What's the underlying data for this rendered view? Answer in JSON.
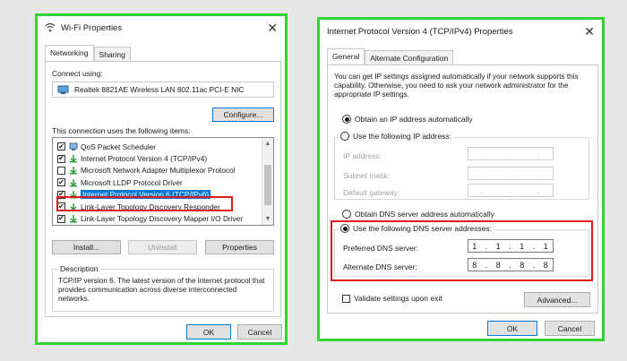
{
  "wifi_dialog": {
    "title": "Wi-Fi Properties",
    "tabs": [
      "Networking",
      "Sharing"
    ],
    "connect_using_label": "Connect using:",
    "adapter_name": "Realtek 8821AE Wireless LAN 802.11ac PCI-E NIC",
    "configure_label": "Configure...",
    "items_label": "This connection uses the following items:",
    "items": [
      {
        "label": "QoS Packet Scheduler",
        "checked": true,
        "icon": "qos-icon"
      },
      {
        "label": "Internet Protocol Version 4 (TCP/IPv4)",
        "checked": true,
        "icon": "protocol-icon"
      },
      {
        "label": "Microsoft Network Adapter Multiplexor Protocol",
        "checked": false,
        "icon": "protocol-icon"
      },
      {
        "label": "Microsoft LLDP Protocol Driver",
        "checked": true,
        "icon": "protocol-icon"
      },
      {
        "label": "Internet Protocol Version 6 (TCP/IPv6)",
        "checked": true,
        "icon": "protocol-icon",
        "selected": true
      },
      {
        "label": "Link-Layer Topology Discovery Responder",
        "checked": true,
        "icon": "protocol-icon"
      },
      {
        "label": "Link-Layer Topology Discovery Mapper I/O Driver",
        "checked": true,
        "icon": "protocol-icon"
      }
    ],
    "install_label": "Install...",
    "uninstall_label": "Uninstall",
    "properties_label": "Properties",
    "description_label": "Description",
    "description_text": "TCP/IP version 6. The latest version of the internet protocol that provides communication across diverse interconnected networks.",
    "ok_label": "OK",
    "cancel_label": "Cancel"
  },
  "ipv4_dialog": {
    "title": "Internet Protocol Version 4 (TCP/IPv4) Properties",
    "tabs": [
      "General",
      "Alternate Configuration"
    ],
    "intro_text": "You can get IP settings assigned automatically if your network supports this capability. Otherwise, you need to ask your network administrator for the appropriate IP settings.",
    "obtain_ip_label": "Obtain an IP address automatically",
    "use_ip_label": "Use the following IP address:",
    "ip_address_label": "IP address:",
    "subnet_mask_label": "Subnet mask:",
    "default_gateway_label": "Default gateway:",
    "empty_ip": [
      ".",
      ".",
      "."
    ],
    "obtain_dns_label": "Obtain DNS server address automatically",
    "use_dns_label": "Use the following DNS server addresses:",
    "preferred_dns_label": "Preferred DNS server:",
    "preferred_dns": [
      "1",
      ".",
      "1",
      ".",
      "1",
      ".",
      "1"
    ],
    "alternate_dns_label": "Alternate DNS server:",
    "alternate_dns": [
      "8",
      ".",
      "8",
      ".",
      "8",
      ".",
      "8"
    ],
    "validate_label": "Validate settings upon exit",
    "advanced_label": "Advanced...",
    "ok_label": "OK",
    "cancel_label": "Cancel"
  },
  "colors": {
    "highlight_green": "#31d431",
    "highlight_red": "#e11a1a",
    "selection_blue": "#0078d7"
  }
}
